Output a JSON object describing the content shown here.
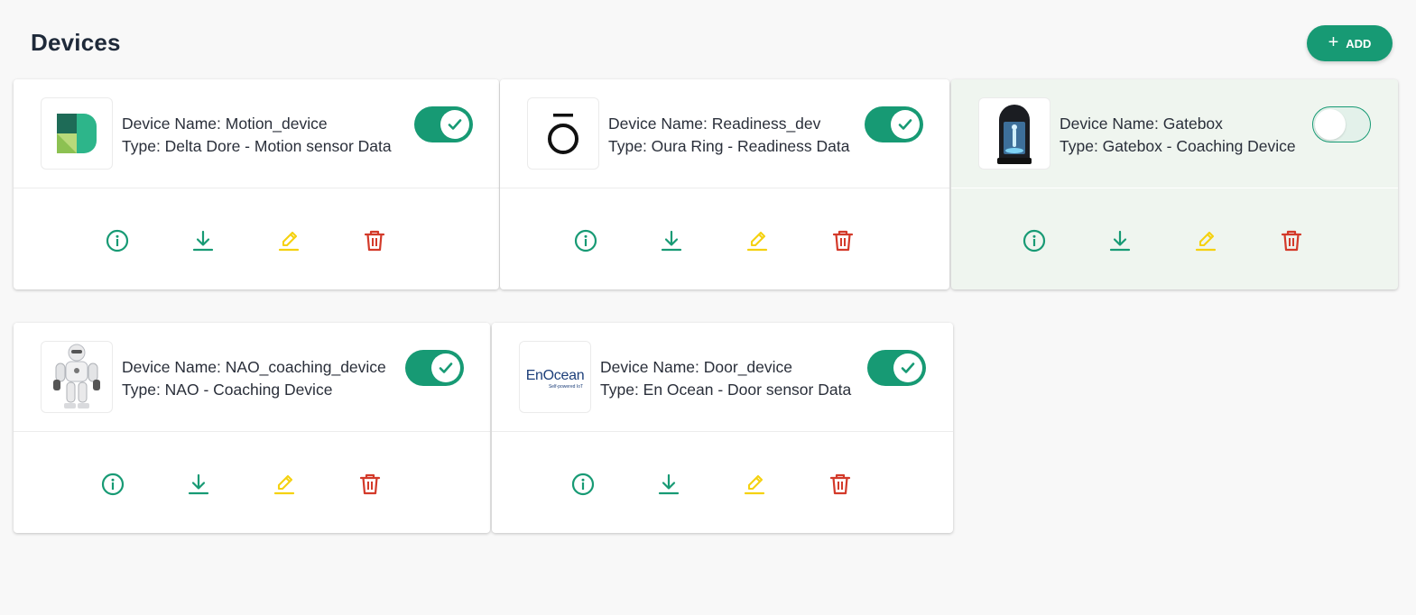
{
  "header": {
    "title": "Devices",
    "add_label": "ADD"
  },
  "colors": {
    "accent": "#179a74",
    "edit": "#f5d10f",
    "delete": "#d33a2a",
    "disabled_card": "#eff5ef"
  },
  "devices": [
    {
      "name_line": "Device Name: Motion_device",
      "type_line": "Type: Delta Dore - Motion sensor Data",
      "enabled": true,
      "logo": "delta-dore-logo"
    },
    {
      "name_line": "Device Name: Readiness_dev",
      "type_line": "Type: Oura Ring - Readiness Data",
      "enabled": true,
      "logo": "oura-logo"
    },
    {
      "name_line": "Device Name: Gatebox",
      "type_line": "Type: Gatebox - Coaching Device",
      "enabled": false,
      "logo": "gatebox-image"
    },
    {
      "name_line": "Device Name: NAO_coaching_device",
      "type_line": "Type: NAO - Coaching Device",
      "enabled": true,
      "logo": "nao-robot-image"
    },
    {
      "name_line": "Device Name: Door_device",
      "type_line": "Type: En Ocean - Door sensor Data",
      "enabled": true,
      "logo": "enocean-logo",
      "logo_text": "EnOcean",
      "logo_subtext": "Self-powered IoT"
    }
  ],
  "actions": [
    "info-icon",
    "download-icon",
    "edit-icon",
    "delete-icon"
  ]
}
